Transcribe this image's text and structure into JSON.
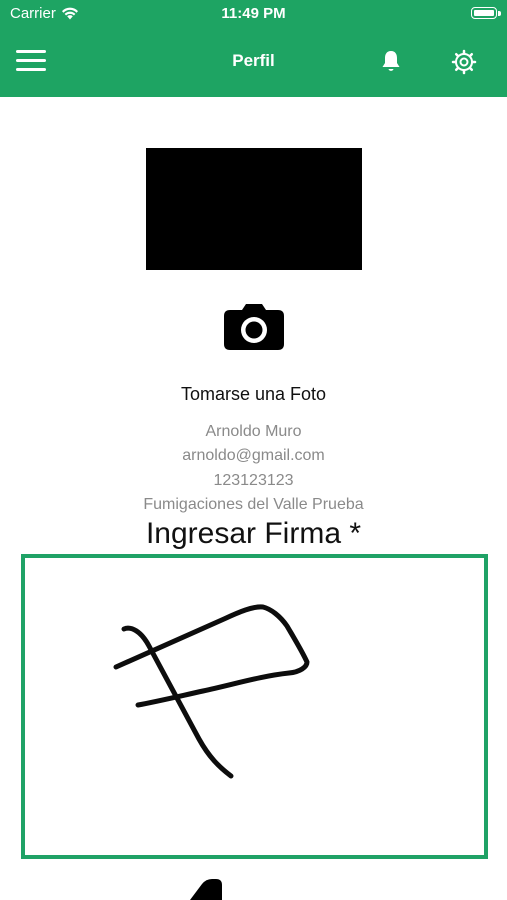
{
  "status_bar": {
    "carrier": "Carrier",
    "time": "11:49 PM"
  },
  "nav": {
    "title": "Perfil",
    "menu_icon": "hamburger-menu-icon",
    "bell_icon": "bell-icon",
    "settings_icon": "gear-icon"
  },
  "profile": {
    "photo_label": "Tomarse una Foto",
    "camera_icon": "camera-icon",
    "name": "Arnoldo Muro",
    "email": "arnoldo@gmail.com",
    "phone": "123123123",
    "company": "Fumigaciones del Valle Prueba"
  },
  "signature": {
    "title": "Ingresar Firma *"
  },
  "colors": {
    "header": "#1ea463",
    "signature_border": "#1fa266",
    "secondary_text": "#8a8a8a"
  }
}
